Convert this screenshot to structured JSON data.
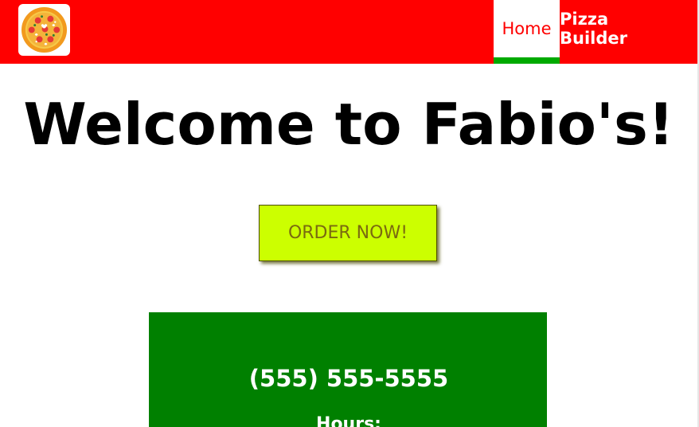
{
  "nav": {
    "logo_icon": "pizza-icon",
    "items": [
      {
        "label": "Home",
        "active": true
      },
      {
        "label": "Pizza Builder",
        "active": false
      }
    ]
  },
  "hero": {
    "title": "Welcome to Fabio's!"
  },
  "cta": {
    "label": "ORDER NOW!"
  },
  "info": {
    "phone": "(555) 555-5555",
    "hours_label": "Hours:"
  },
  "colors": {
    "navbar": "#ff0000",
    "active_underline": "#00aa00",
    "cta_background": "#ccff00",
    "info_background": "#008000"
  }
}
